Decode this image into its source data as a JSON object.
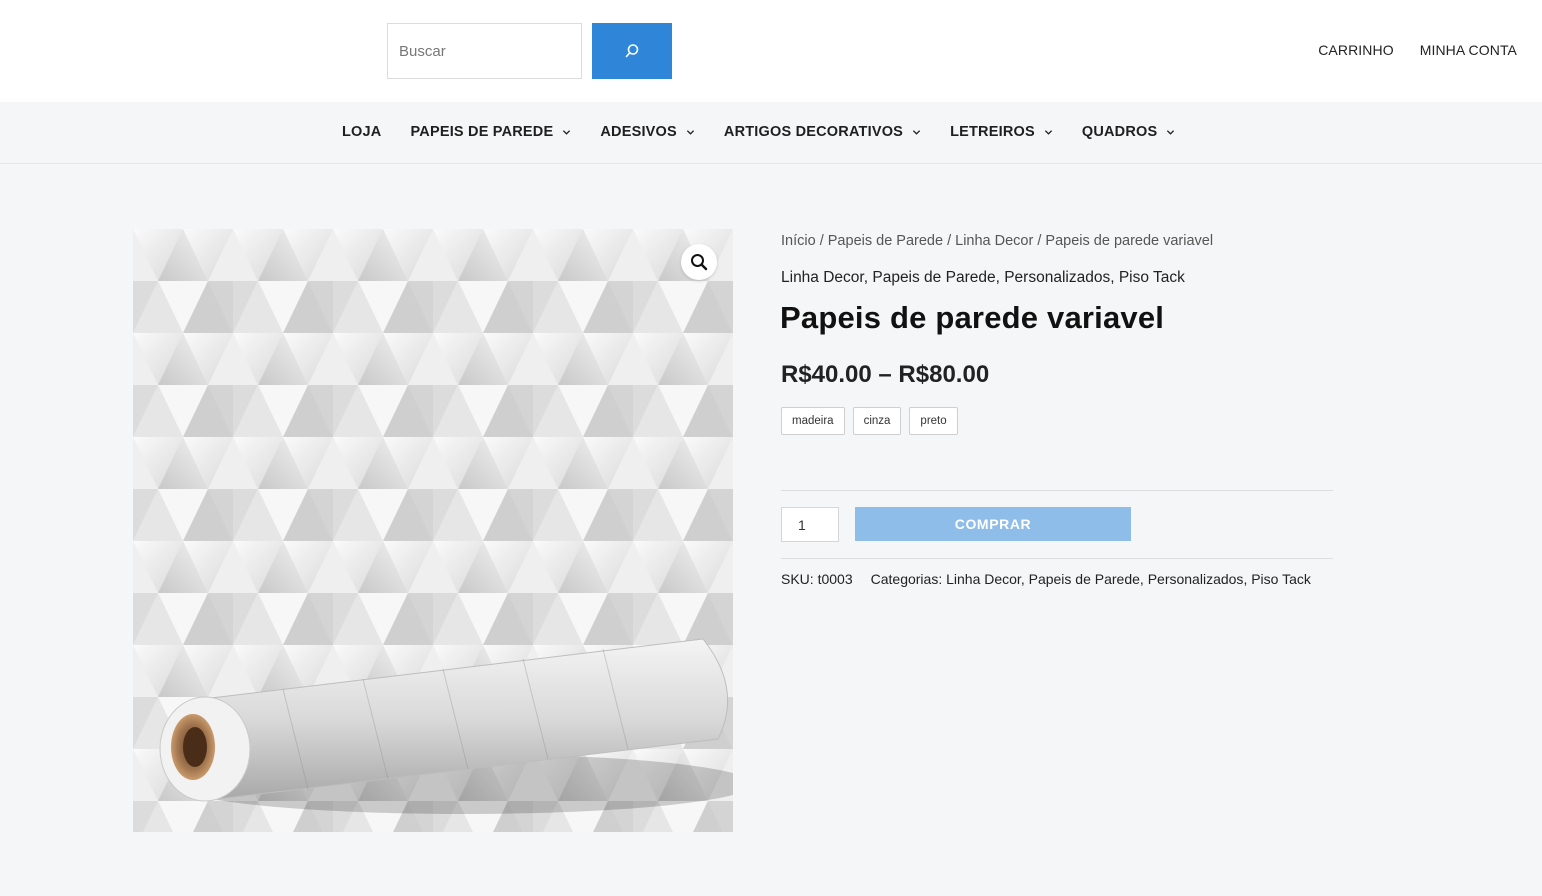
{
  "header": {
    "search_placeholder": "Buscar",
    "cart_label": "CARRINHO",
    "account_label": "MINHA CONTA"
  },
  "nav": {
    "items": [
      {
        "label": "LOJA"
      },
      {
        "label": "PAPEIS DE PAREDE"
      },
      {
        "label": "ADESIVOS"
      },
      {
        "label": "ARTIGOS DECORATIVOS"
      },
      {
        "label": "LETREIROS"
      },
      {
        "label": "QUADROS"
      }
    ]
  },
  "breadcrumb": {
    "items": [
      "Início",
      "Papeis de Parede",
      "Linha Decor"
    ],
    "separator": " / ",
    "current": "Papeis de parede variavel"
  },
  "product": {
    "categories_line": [
      "Linha Decor",
      "Papeis de Parede",
      "Personalizados",
      "Piso Tack"
    ],
    "title": "Papeis de parede variavel",
    "price_range": "R$40.00 – R$80.00",
    "swatches": [
      "madeira",
      "cinza",
      "preto"
    ],
    "quantity": "1",
    "buy_label": "COMPRAR",
    "sku_label": "SKU:",
    "sku_value": "t0003",
    "categories_label": "Categorias:",
    "categories": [
      "Linha Decor",
      "Papeis de Parede",
      "Personalizados",
      "Piso Tack"
    ]
  },
  "colors": {
    "accent": "#2f86d9",
    "buy_button": "#8dbde8",
    "background": "#f5f6f8"
  },
  "icons": {
    "search": "search-icon",
    "zoom": "magnifier-icon",
    "dropdown": "chevron-down-icon"
  }
}
